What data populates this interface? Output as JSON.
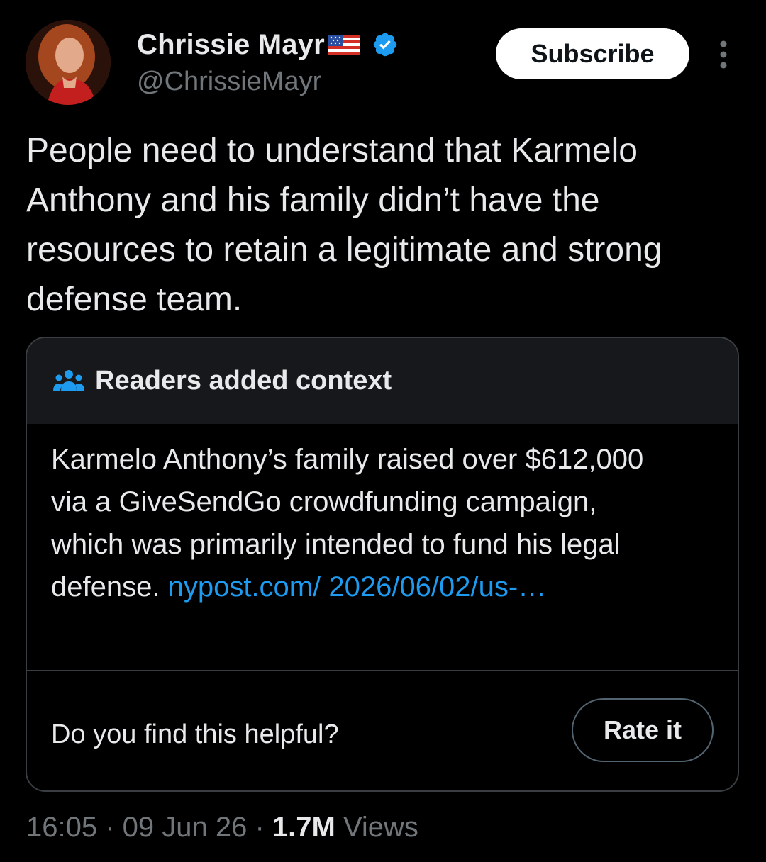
{
  "author": {
    "display_name": "Chrissie Mayr",
    "handle": "@ChrissieMayr",
    "verified": true,
    "badge_color": "#1d9bf0"
  },
  "actions": {
    "subscribe_label": "Subscribe"
  },
  "tweet": {
    "text": "People need to understand that Karmelo Anthony and his family didn’t have the resources to retain a legitimate and strong defense team."
  },
  "community_note": {
    "title": "Readers added context",
    "body": "Karmelo Anthony’s family raised over $612,000 via a GiveSendGo crowdfunding campaign, which was primarily intended to fund his legal defense. ",
    "link_text": "nypost.com/ 2026/06/02/us-…",
    "helpful_question": "Do you find this helpful?",
    "rate_label": "Rate it"
  },
  "meta": {
    "time": "16:05",
    "separator": " · ",
    "date": "09 Jun 26",
    "views_count": "1.7M",
    "views_label": " Views"
  },
  "colors": {
    "background": "#000000",
    "link": "#1d9bf0",
    "muted": "#71767b",
    "card_header": "#16181c"
  }
}
